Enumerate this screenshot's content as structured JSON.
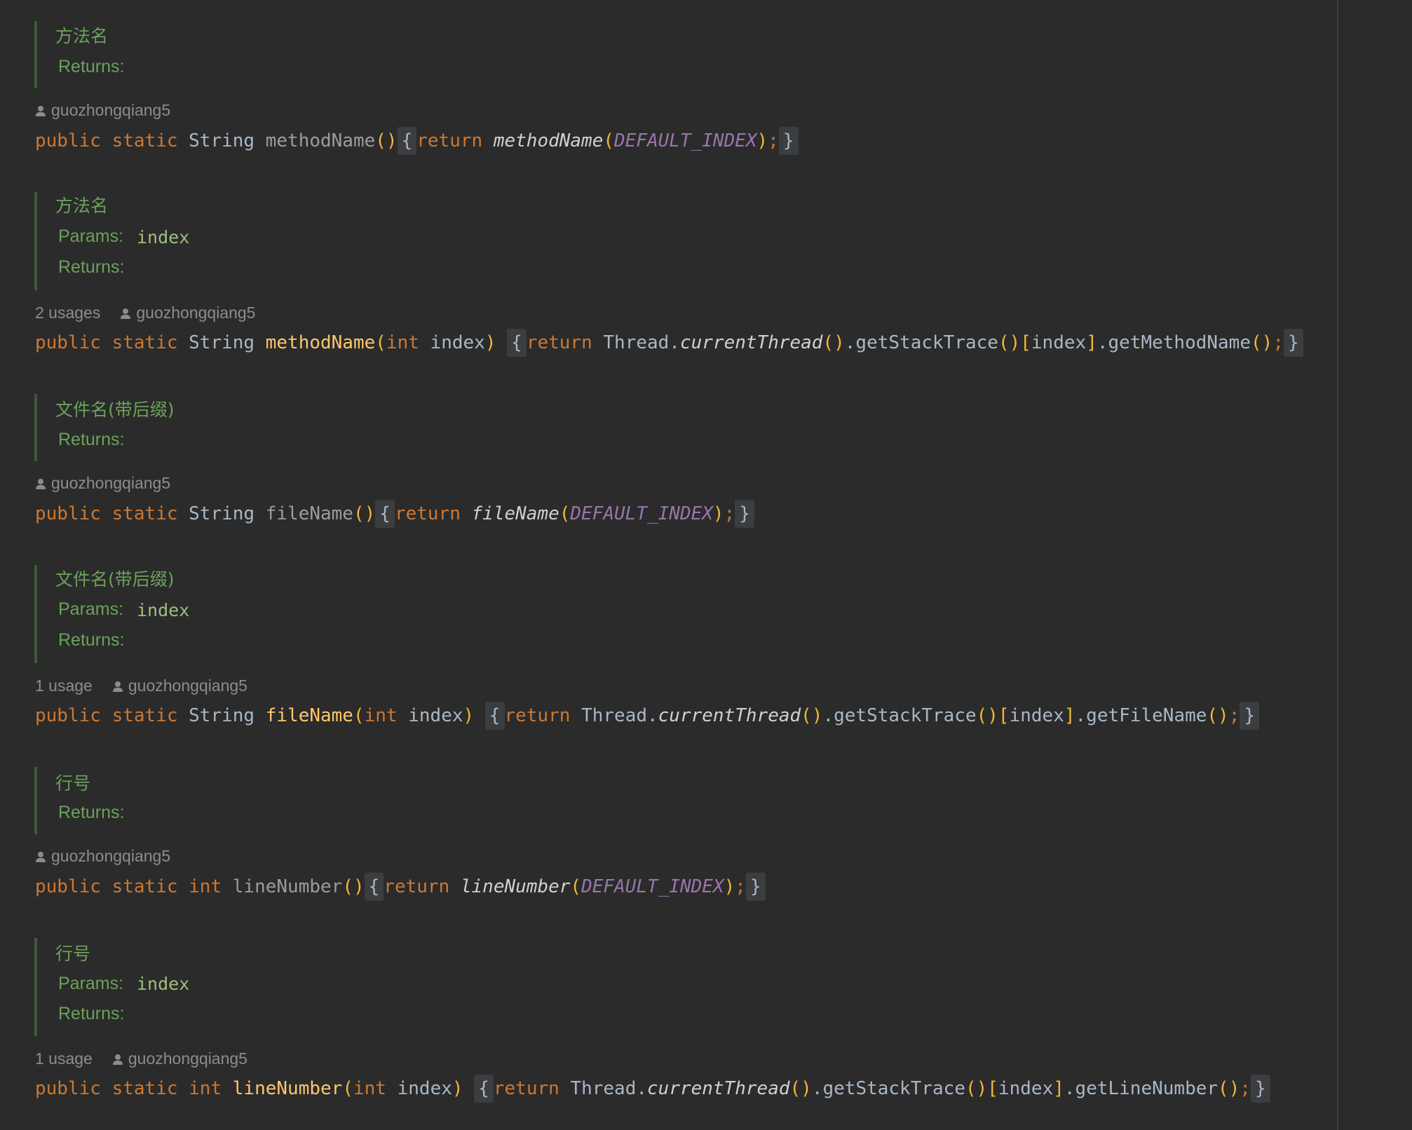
{
  "blocks": [
    {
      "doc_title": "方法名",
      "params_label": "",
      "param": "",
      "returns_label": "Returns:",
      "usages": "",
      "author": "guozhongqiang5",
      "code": {
        "kw_public": "public",
        "kw_static": "static",
        "ret_type": "String",
        "name": "methodName",
        "params_open": "()",
        "param_type": "",
        "param_name": "",
        "params_close": "",
        "open_brace": "{",
        "kw_return": "return",
        "body": "methodName",
        "body_open": "(",
        "arg": "DEFAULT_INDEX",
        "body_close": ")",
        "semicolon": ";",
        "close_brace": "}"
      }
    },
    {
      "doc_title": "方法名",
      "params_label": "Params:",
      "param": "index",
      "returns_label": "Returns:",
      "usages": "2 usages",
      "author": "guozhongqiang5",
      "code": {
        "kw_public": "public",
        "kw_static": "static",
        "ret_type": "String",
        "name": "methodName",
        "param_type": "int",
        "param_name": "index",
        "open_brace": "{",
        "kw_return": "return",
        "receiver": "Thread.",
        "static_call": "currentThread",
        "chain1": ".getStackTrace",
        "index_expr": "index",
        "chain2": ".getMethodName",
        "semicolon": ";",
        "close_brace": "}"
      }
    },
    {
      "doc_title": "文件名(带后缀)",
      "params_label": "",
      "param": "",
      "returns_label": "Returns:",
      "usages": "",
      "author": "guozhongqiang5",
      "code": {
        "kw_public": "public",
        "kw_static": "static",
        "ret_type": "String",
        "name": "fileName",
        "params_open": "()",
        "open_brace": "{",
        "kw_return": "return",
        "body": "fileName",
        "body_open": "(",
        "arg": "DEFAULT_INDEX",
        "body_close": ")",
        "semicolon": ";",
        "close_brace": "}"
      }
    },
    {
      "doc_title": "文件名(带后缀)",
      "params_label": "Params:",
      "param": "index",
      "returns_label": "Returns:",
      "usages": "1 usage",
      "author": "guozhongqiang5",
      "code": {
        "kw_public": "public",
        "kw_static": "static",
        "ret_type": "String",
        "name": "fileName",
        "param_type": "int",
        "param_name": "index",
        "open_brace": "{",
        "kw_return": "return",
        "receiver": "Thread.",
        "static_call": "currentThread",
        "chain1": ".getStackTrace",
        "index_expr": "index",
        "chain2": ".getFileName",
        "semicolon": ";",
        "close_brace": "}"
      }
    },
    {
      "doc_title": "行号",
      "params_label": "",
      "param": "",
      "returns_label": "Returns:",
      "usages": "",
      "author": "guozhongqiang5",
      "code": {
        "kw_public": "public",
        "kw_static": "static",
        "ret_type": "int",
        "name": "lineNumber",
        "params_open": "()",
        "open_brace": "{",
        "kw_return": "return",
        "body": "lineNumber",
        "body_open": "(",
        "arg": "DEFAULT_INDEX",
        "body_close": ")",
        "semicolon": ";",
        "close_brace": "}"
      }
    },
    {
      "doc_title": "行号",
      "params_label": "Params:",
      "param": "index",
      "returns_label": "Returns:",
      "usages": "1 usage",
      "author": "guozhongqiang5",
      "code": {
        "kw_public": "public",
        "kw_static": "static",
        "ret_type": "int",
        "name": "lineNumber",
        "param_type": "int",
        "param_name": "index",
        "open_brace": "{",
        "kw_return": "return",
        "receiver": "Thread.",
        "static_call": "currentThread",
        "chain1": ".getStackTrace",
        "index_expr": "index",
        "chain2": ".getLineNumber",
        "semicolon": ";",
        "close_brace": "}"
      }
    }
  ],
  "colors": {
    "background": "#2b2b2b",
    "doc_text": "#6aa25a",
    "keyword": "#cc7832",
    "declaration": "#ffc66d",
    "constant": "#9876aa",
    "hint": "#8a8d90"
  },
  "icons": {
    "author": "person-icon"
  }
}
